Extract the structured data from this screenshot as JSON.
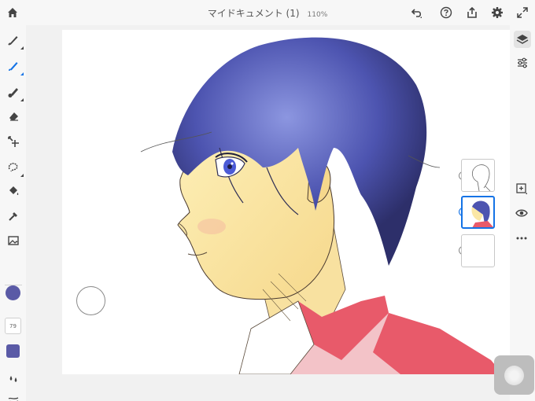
{
  "document": {
    "title": "マイドキュメント (1)",
    "zoom": "110%"
  },
  "topbar": {
    "icons": [
      "home-icon",
      "undo-icon",
      "help-icon",
      "share-icon",
      "settings-icon",
      "fullscreen-icon"
    ]
  },
  "left_toolbar": {
    "tools": [
      "pixel-brush-icon",
      "live-brush-icon",
      "vector-brush-icon",
      "eraser-icon",
      "transform-icon",
      "selection-icon",
      "fill-icon",
      "eyedropper-icon",
      "image-icon"
    ],
    "active_tool": "live-brush-icon",
    "color": "#5a5aa6",
    "brush_size": "79",
    "flow_color": "#5a5aa6"
  },
  "right_panel": {
    "icons": [
      "layers-icon",
      "adjustments-icon",
      "add-layer-icon",
      "visibility-icon",
      "more-icon"
    ]
  },
  "layers": [
    {
      "name": "sketch-layer",
      "selected": false
    },
    {
      "name": "color-layer",
      "selected": true
    },
    {
      "name": "empty-layer",
      "selected": false
    }
  ],
  "colors": {
    "accent": "#1473e6",
    "hair": "#4d54b0",
    "skin": "#fbe7a6",
    "jacket": "#e85a6a"
  }
}
